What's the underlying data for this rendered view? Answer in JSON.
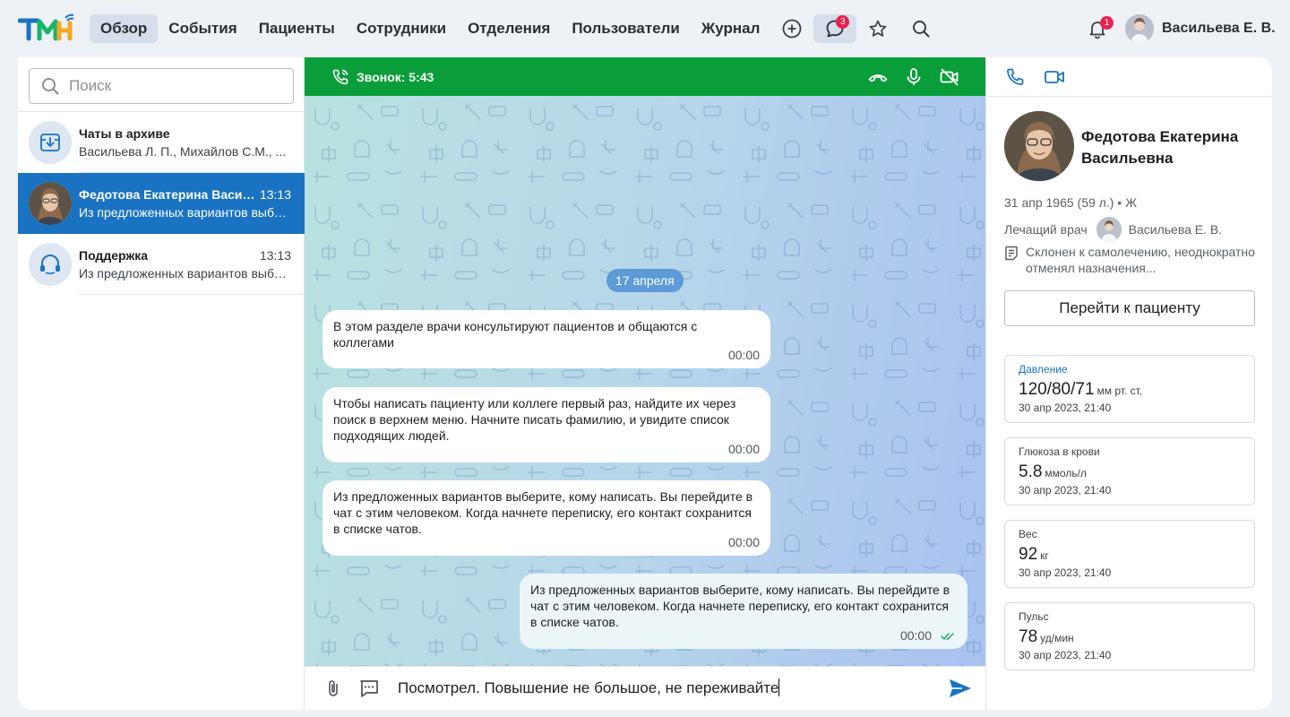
{
  "header": {
    "nav": [
      {
        "label": "Обзор",
        "active": true
      },
      {
        "label": "События"
      },
      {
        "label": "Пациенты"
      },
      {
        "label": "Сотрудники"
      },
      {
        "label": "Отделения"
      },
      {
        "label": "Пользователи"
      },
      {
        "label": "Журнал"
      }
    ],
    "chat_badge": "3",
    "bell_badge": "1",
    "user_name": "Васильева Е. В.",
    "colors": {
      "active_bg": "#d5deea",
      "badge": "#e8224b",
      "logo_blue": "#1a73c2",
      "logo_green": "#19b46b",
      "logo_orange": "#f5a623"
    }
  },
  "sidebar": {
    "search_placeholder": "Поиск",
    "chats": [
      {
        "title": "Чаты в архиве",
        "time": "",
        "preview": "Васильева Л. П., Михайлов С.М., ...",
        "icon": "archive-icon"
      },
      {
        "title": "Федотова Екатерина Васильевна",
        "time": "13:13",
        "preview": "Из предложенных вариантов выберите, кому написать.",
        "selected": true
      },
      {
        "title": "Поддержка",
        "time": "13:13",
        "preview": "Из предложенных вариантов выберите, кому написать.",
        "icon": "support-icon"
      }
    ],
    "selected_color": "#1a73c2"
  },
  "call": {
    "label": "Звонок: 5:43",
    "color": "#0a9e3a"
  },
  "chat": {
    "date_chip": "17 апреля",
    "messages": [
      {
        "text": "В этом разделе врачи консультируют пациентов и общаются с коллегами",
        "time": "00:00",
        "outgoing": false
      },
      {
        "text": "Чтобы написать пациенту или коллеге первый раз, найдите их через поиск в верхнем меню. Начните писать фамилию, и увидите список подходящих людей.",
        "time": "00:00",
        "outgoing": false
      },
      {
        "text": "Из предложенных вариантов выберите, кому написать. Вы перейдите в чат с этим человеком. Когда начнете переписку, его контакт сохранится в списке чатов.",
        "time": "00:00",
        "outgoing": false
      },
      {
        "text": "Из предложенных вариантов выберите, кому написать. Вы перейдите в чат с этим человеком. Когда начнете переписку, его контакт сохранится в списке чатов.",
        "time": "00:00",
        "outgoing": true
      }
    ],
    "draft": "Посмотрел. Повышение не большое, не переживайте"
  },
  "patient": {
    "name": "Федотова Екатерина Васильевна",
    "info": "31 апр 1965 (59 л.) • Ж",
    "doctor_label": "Лечащий врач",
    "doctor_name": "Васильева Е. В.",
    "note": "Склонен к самолечению, неоднократно отменял назначения...",
    "go_button": "Перейти к пациенту",
    "vitals": [
      {
        "label": "Давление",
        "value": "120/80/71",
        "unit": "мм рт. ст.",
        "date": "30 апр 2023, 21:40",
        "highlight": true
      },
      {
        "label": "Глюкоза в крови",
        "value": "5.8",
        "unit": "ммоль/л",
        "date": "30 апр 2023, 21:40"
      },
      {
        "label": "Вес",
        "value": "92",
        "unit": "кг",
        "date": "30 апр 2023, 21:40"
      },
      {
        "label": "Пульс",
        "value": "78",
        "unit": "уд/мин",
        "date": "30 апр 2023, 21:40"
      }
    ]
  }
}
